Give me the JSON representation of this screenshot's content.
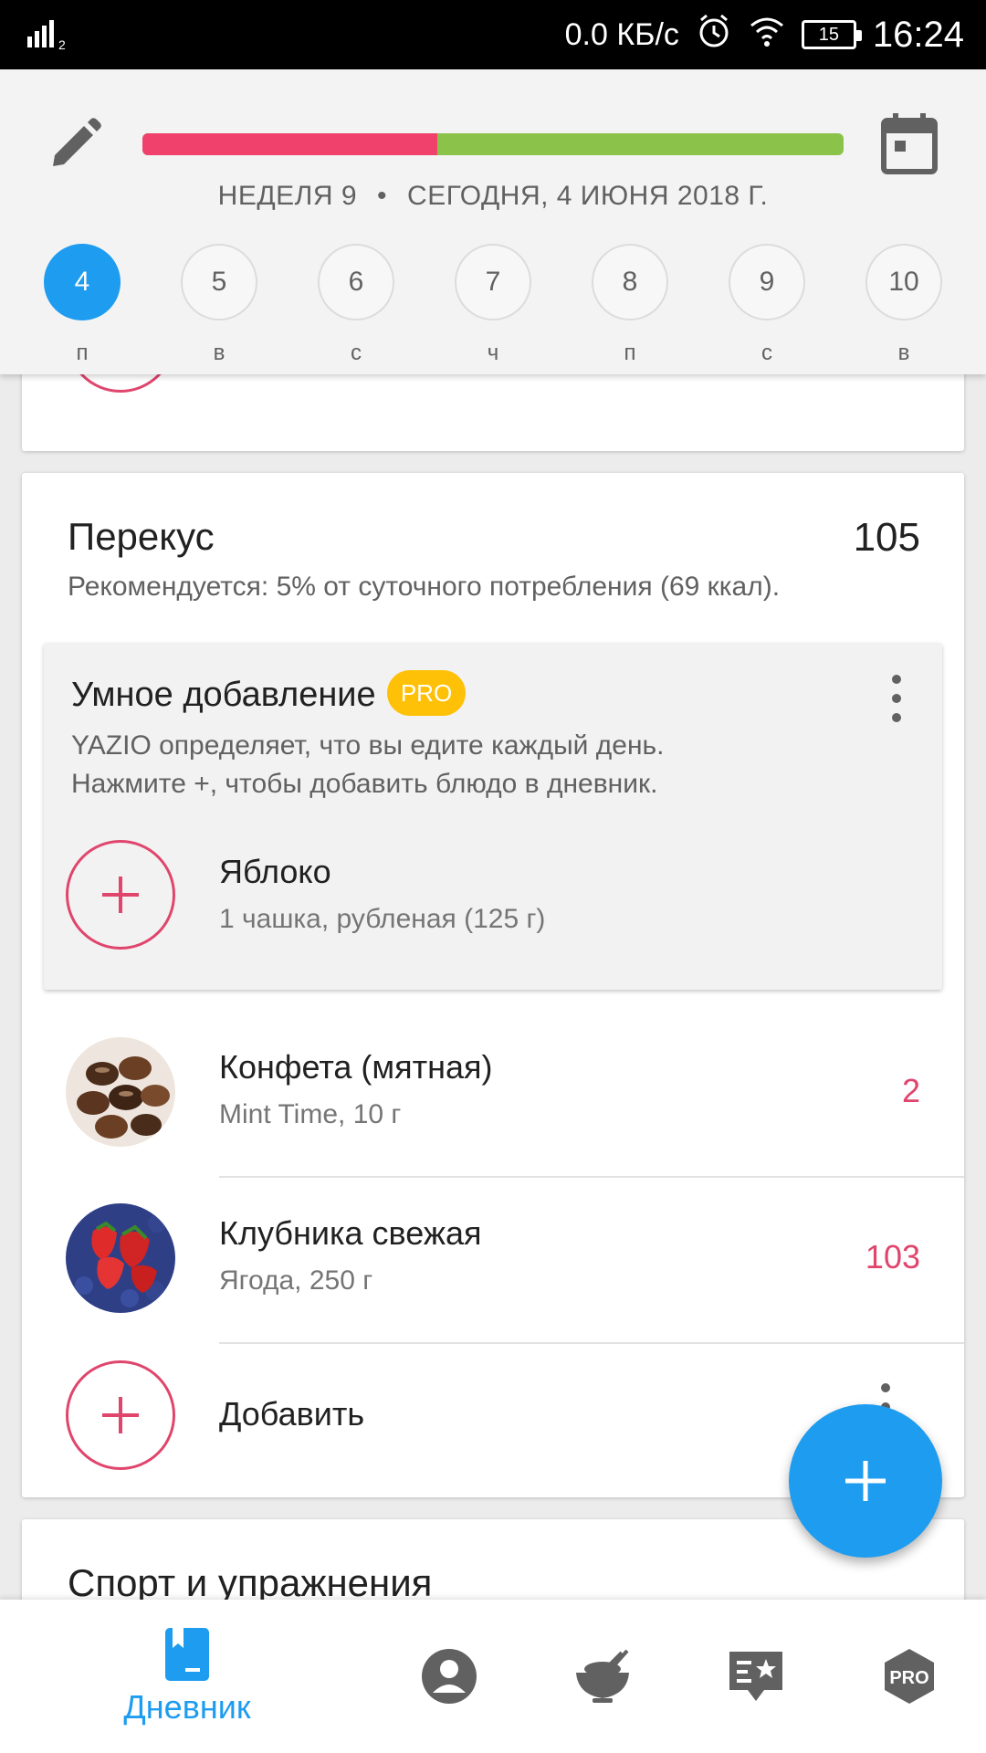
{
  "status_bar": {
    "network_speed": "0.0 КБ/с",
    "battery": "15",
    "time": "16:24",
    "sim": "2"
  },
  "header": {
    "week": "НЕДЕЛЯ 9",
    "separator": "•",
    "today": "СЕГОДНЯ, 4 ИЮНЯ 2018 Г.",
    "progress": {
      "consumed_fraction": 0.42,
      "colors": {
        "consumed": "#f0416c",
        "remaining": "#8bc34a"
      }
    },
    "days": [
      {
        "num": "4",
        "label": "п",
        "active": true
      },
      {
        "num": "5",
        "label": "в",
        "active": false
      },
      {
        "num": "6",
        "label": "с",
        "active": false
      },
      {
        "num": "7",
        "label": "ч",
        "active": false
      },
      {
        "num": "8",
        "label": "п",
        "active": false
      },
      {
        "num": "9",
        "label": "с",
        "active": false
      },
      {
        "num": "10",
        "label": "в",
        "active": false
      }
    ]
  },
  "snack": {
    "title": "Перекус",
    "kcal": "105",
    "recommendation": "Рекомендуется: 5% от суточного потребления (69 ккал).",
    "smart_add": {
      "title": "Умное добавление",
      "badge": "PRO",
      "desc_line1": "YAZIO определяет, что вы едите каждый день.",
      "desc_line2": "Нажмите +, чтобы добавить блюдо в дневник.",
      "item_name": "Яблоко",
      "item_portion": "1 чашка, рубленая (125 г)"
    },
    "items": [
      {
        "name": "Конфета (мятная)",
        "detail": "Mint Time, 10 г",
        "kcal": "2"
      },
      {
        "name": "Клубника свежая",
        "detail": "Ягода, 250 г",
        "kcal": "103"
      }
    ],
    "add_label": "Добавить"
  },
  "sport": {
    "title": "Спорт и упражнения"
  },
  "bottom_nav": {
    "diary_label": "Дневник",
    "pro_label": "PRO",
    "icons": [
      "diary-icon",
      "profile-icon",
      "recipes-icon",
      "analysis-icon",
      "pro-icon"
    ]
  },
  "colors": {
    "accent": "#1e9cf0",
    "pink": "#e0456c",
    "pro": "#ffc107"
  }
}
